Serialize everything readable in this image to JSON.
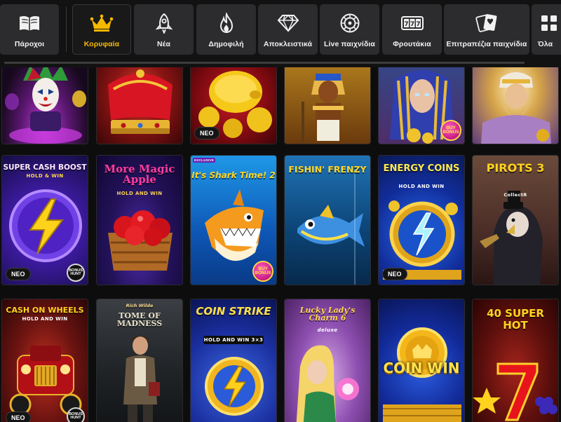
{
  "categories": [
    {
      "label": "Πάροχοι",
      "icon": "book-icon",
      "active": false
    },
    {
      "label": "Κορυφαία",
      "icon": "crown-icon",
      "active": true
    },
    {
      "label": "Νέα",
      "icon": "rocket-icon",
      "active": false
    },
    {
      "label": "Δημοφιλή",
      "icon": "flame-icon",
      "active": false
    },
    {
      "label": "Αποκλειστικά",
      "icon": "diamond-icon",
      "active": false
    },
    {
      "label": "Live παιχνίδια",
      "icon": "roulette-icon",
      "active": false
    },
    {
      "label": "Φρουτάκια",
      "icon": "slot-machine-icon",
      "active": false
    },
    {
      "label": "Επιτραπέζια παιχνίδια",
      "icon": "cards-icon",
      "active": false
    },
    {
      "label": "Όλα",
      "icon": "grid-icon",
      "active": false
    }
  ],
  "badges": {
    "new": "ΝΕΟ",
    "bonus": "BUY BONUS",
    "hunt": "BONUS HUNT",
    "exclusive": "EXCLUSIVE"
  },
  "games_row1": [
    {
      "title": "",
      "art": "joker-icon"
    },
    {
      "title": "",
      "art": "crown-icon"
    },
    {
      "title": "",
      "art": "gold-pig-icon",
      "new": true
    },
    {
      "title": "",
      "art": "pharaoh-icon"
    },
    {
      "title": "",
      "art": "cleopatra-icon",
      "bonus": true
    },
    {
      "title": "",
      "art": "zeus-icon"
    }
  ],
  "games_row2": [
    {
      "title": "SUPER CASH BOOST",
      "subtitle": "HOLD & WIN",
      "art": "lightning-icon",
      "new": true,
      "hunt": true
    },
    {
      "title": "More Magic Apple",
      "subtitle": "HOLD AND WIN",
      "art": "apple-basket-icon"
    },
    {
      "title": "It's Shark Time! 2",
      "art": "shark-icon",
      "exclusive": true,
      "bonus": true
    },
    {
      "title": "FISHIN' FRENZY",
      "art": "fish-icon"
    },
    {
      "title": "ENERGY COINS",
      "subtitle": "HOLD AND WIN",
      "art": "energy-orb-icon",
      "new": true
    },
    {
      "title": "PIROTS 3",
      "subtitle": "CollectR",
      "art": "vulture-icon"
    }
  ],
  "games_row3": [
    {
      "title": "CASH ON WHEELS",
      "subtitle": "HOLD AND WIN",
      "art": "car-icon",
      "new": true,
      "hunt": true
    },
    {
      "title": "TOME OF MADNESS",
      "subtitle": "Rich Wilde",
      "art": "explorer-icon"
    },
    {
      "title": "COIN STRIKE",
      "subtitle": "HOLD AND WIN 3×3",
      "art": "coin-lightning-icon"
    },
    {
      "title": "Lucky Lady's Charm 6",
      "subtitle": "deluxe",
      "art": "lady-icon"
    },
    {
      "title": "COIN WIN",
      "art": "gold-coin-icon"
    },
    {
      "title": "40 SUPER HOT",
      "art": "seven-icon"
    }
  ]
}
